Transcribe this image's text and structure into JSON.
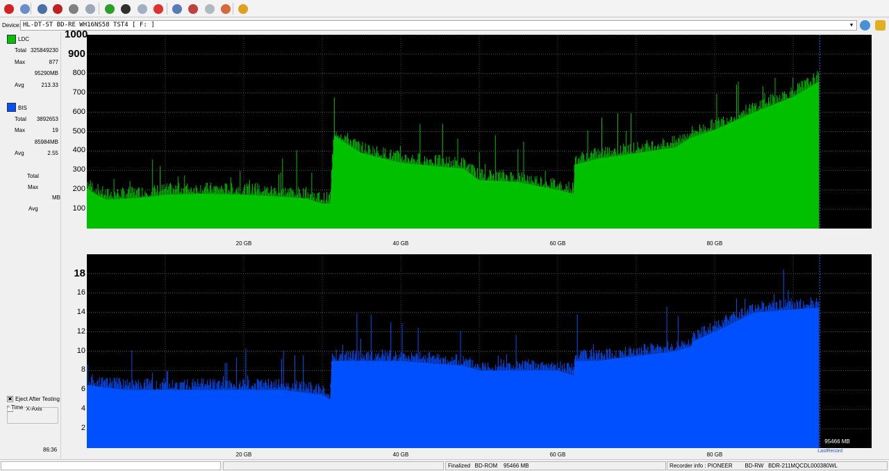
{
  "toolbar": {
    "buttons": [
      {
        "name": "power-icon",
        "color": "#d42020"
      },
      {
        "name": "wrench-icon",
        "color": "#6a8fc8"
      },
      {
        "name": "drive-info-icon",
        "color": "#4a6ea8"
      },
      {
        "name": "disc-red-icon",
        "color": "#c02020"
      },
      {
        "name": "disc-gray-icon",
        "color": "#808080"
      },
      {
        "name": "copy-disc-icon",
        "color": "#9aa8b8"
      },
      {
        "name": "refresh-icon",
        "color": "#2aa02a"
      },
      {
        "name": "burn-icon",
        "color": "#303030"
      },
      {
        "name": "verify-icon",
        "color": "#a0b0c0"
      },
      {
        "name": "stop-icon",
        "color": "#e03030"
      },
      {
        "name": "disc-blank-icon",
        "color": "#5a7ab8"
      },
      {
        "name": "eraser-icon",
        "color": "#c04040"
      },
      {
        "name": "scan-icon",
        "color": "#b0b8c0"
      },
      {
        "name": "palette-icon",
        "color": "#d86a3a"
      },
      {
        "name": "chart-icon",
        "color": "#e0a020"
      }
    ]
  },
  "device": {
    "label": "Device:",
    "value": "HL-DT-ST BD-RE  WH16NS58  TST4 [ F: ]"
  },
  "ldc": {
    "title": "LDC",
    "color": "#00c000",
    "total_label": "Total",
    "total": "325849230",
    "max_label": "Max",
    "max": "877",
    "max_mb": "95290MB",
    "avg_label": "Avg",
    "avg": "213.33"
  },
  "bis": {
    "title": "BIS",
    "color": "#0050ff",
    "total_label": "Total",
    "total": "3892653",
    "max_label": "Max",
    "max": "19",
    "max_mb": "85984MB",
    "avg_label": "Avg",
    "avg": "2.55"
  },
  "extra": {
    "total_label": "Total",
    "max_label": "Max",
    "mb_label": "MB",
    "avg_label": "Avg"
  },
  "options": {
    "eject_label": "Eject After Testing",
    "eject_checked": true,
    "mmx_label": "MM X-Axis",
    "mmx_checked": false
  },
  "time": {
    "label": "Time",
    "value": "86:36"
  },
  "chart_data": [
    {
      "type": "area",
      "title": "LDC",
      "color": "#00c000",
      "xlim": [
        0,
        100
      ],
      "ylim": [
        0,
        1000
      ],
      "yticks": [
        "100",
        "200",
        "300",
        "400",
        "500",
        "600",
        "700",
        "800",
        "900",
        "1000"
      ],
      "xticks": [
        "20 GB",
        "40 GB",
        "60 GB",
        "80 GB"
      ],
      "x": [
        0,
        1,
        2.5,
        5,
        8,
        10,
        15,
        20,
        25,
        28,
        30,
        31,
        31.5,
        35,
        40,
        45,
        48,
        50,
        53,
        55,
        60,
        62,
        62.2,
        65,
        70,
        75,
        77,
        80,
        85,
        90,
        93.3
      ],
      "y": [
        210,
        180,
        150,
        155,
        165,
        175,
        180,
        175,
        165,
        155,
        130,
        130,
        480,
        390,
        340,
        320,
        310,
        250,
        245,
        240,
        200,
        180,
        330,
        360,
        390,
        420,
        470,
        510,
        600,
        680,
        760
      ],
      "grid": true
    },
    {
      "type": "area",
      "title": "BIS",
      "color": "#0050ff",
      "xlim": [
        0,
        100
      ],
      "ylim": [
        0,
        20
      ],
      "yticks": [
        "2",
        "4",
        "6",
        "8",
        "10",
        "12",
        "14",
        "16",
        "18"
      ],
      "xticks": [
        "20 GB",
        "40 GB",
        "60 GB",
        "80 GB"
      ],
      "x": [
        0,
        5,
        10,
        20,
        25,
        30,
        31,
        31.2,
        35,
        40,
        48,
        50,
        55,
        60,
        62,
        62.2,
        65,
        70,
        75,
        77,
        77.2,
        80,
        85,
        93.3
      ],
      "y": [
        6.5,
        6,
        6,
        6,
        6,
        5.5,
        5,
        9,
        9,
        9,
        8.5,
        8,
        8,
        8,
        7.5,
        9,
        9,
        9.5,
        10,
        10.5,
        11,
        12,
        14,
        14.5
      ],
      "grid": true,
      "annotation": "95466 MB",
      "last_record_label": "LastRecord"
    }
  ],
  "status": {
    "empty1": "",
    "empty2": "",
    "disc_info": "Finalized   BD-ROM    95466 MB",
    "recorder_info": "Recorder info : PIONEER        BD-RW   BDR-211MQCDL000380WL"
  }
}
